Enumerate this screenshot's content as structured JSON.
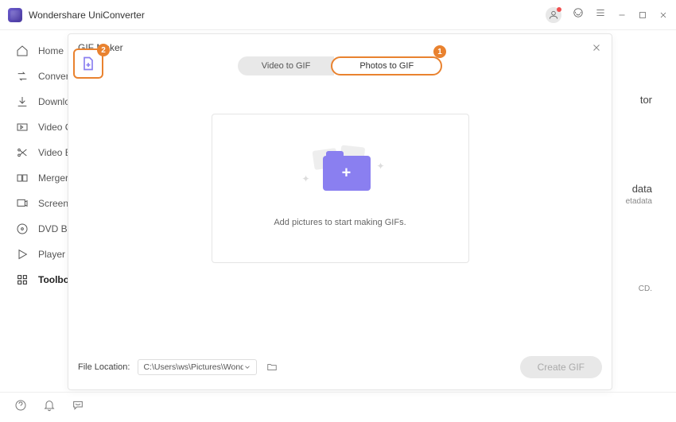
{
  "app": {
    "title": "Wondershare UniConverter"
  },
  "sidebar": {
    "items": [
      {
        "label": "Home"
      },
      {
        "label": "Converter"
      },
      {
        "label": "Downloader"
      },
      {
        "label": "Video Compressor"
      },
      {
        "label": "Video Editor"
      },
      {
        "label": "Merger"
      },
      {
        "label": "Screen Recorder"
      },
      {
        "label": "DVD Burner"
      },
      {
        "label": "Player"
      },
      {
        "label": "Toolbox"
      }
    ]
  },
  "modal": {
    "title": "GIF Maker",
    "tabs": {
      "video": "Video to GIF",
      "photos": "Photos to GIF"
    },
    "dropzone_text": "Add pictures to start making GIFs.",
    "file_location_label": "File Location:",
    "file_location_value": "C:\\Users\\ws\\Pictures\\Wonders",
    "create_button": "Create GIF",
    "badges": {
      "add": "2",
      "photos_tab": "1"
    }
  },
  "background": {
    "tor": "tor",
    "data": "data",
    "etadata": "etadata",
    "cd": "CD."
  }
}
